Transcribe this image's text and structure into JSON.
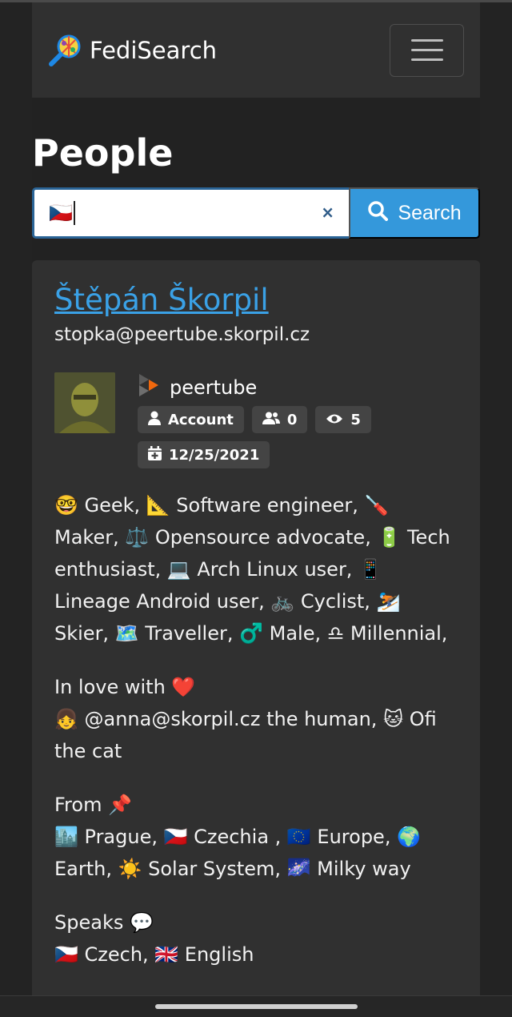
{
  "navbar": {
    "brand": "FediSearch",
    "menu_icon": "hamburger-icon"
  },
  "page": {
    "title": "People"
  },
  "search": {
    "value": "🇨🇿",
    "clear": "×",
    "button_label": "Search"
  },
  "result": {
    "name": "Štěpán Škorpil",
    "handle": "stopka@peertube.skorpil.cz",
    "platform": "peertube",
    "badges": {
      "type": "Account",
      "followers": "0",
      "views": "5",
      "date": "12/25/2021"
    },
    "bio": {
      "p1": "🤓 Geek, 📐 Software engineer, 🪛 Maker, ⚖️ Opensource advocate, 🔋 Tech enthusiast, 💻 Arch Linux user, 📱 Lineage Android user, 🚲 Cyclist, ⛷️ Skier, 🗺️ Traveller, ♂️ Male, ♎ Millennial,",
      "p2_line1": "In love with ❤️",
      "p2_line2": "👧 @anna@skorpil.cz the human, 🐱 Ofi the cat",
      "p3_line1": "From 📌",
      "p3_line2": "🏙️ Prague, 🇨🇿 Czechia , 🇪🇺 Europe, 🌍 Earth, ☀️ Solar System, 🌌 Milky way",
      "p4_line1": "Speaks 💬",
      "p4_line2": "🇨🇿 Czech, 🇬🇧 English"
    }
  },
  "colors": {
    "background": "#222222",
    "card": "#303030",
    "accent": "#3498db",
    "link": "#3aa1e6",
    "badge": "#444444"
  }
}
